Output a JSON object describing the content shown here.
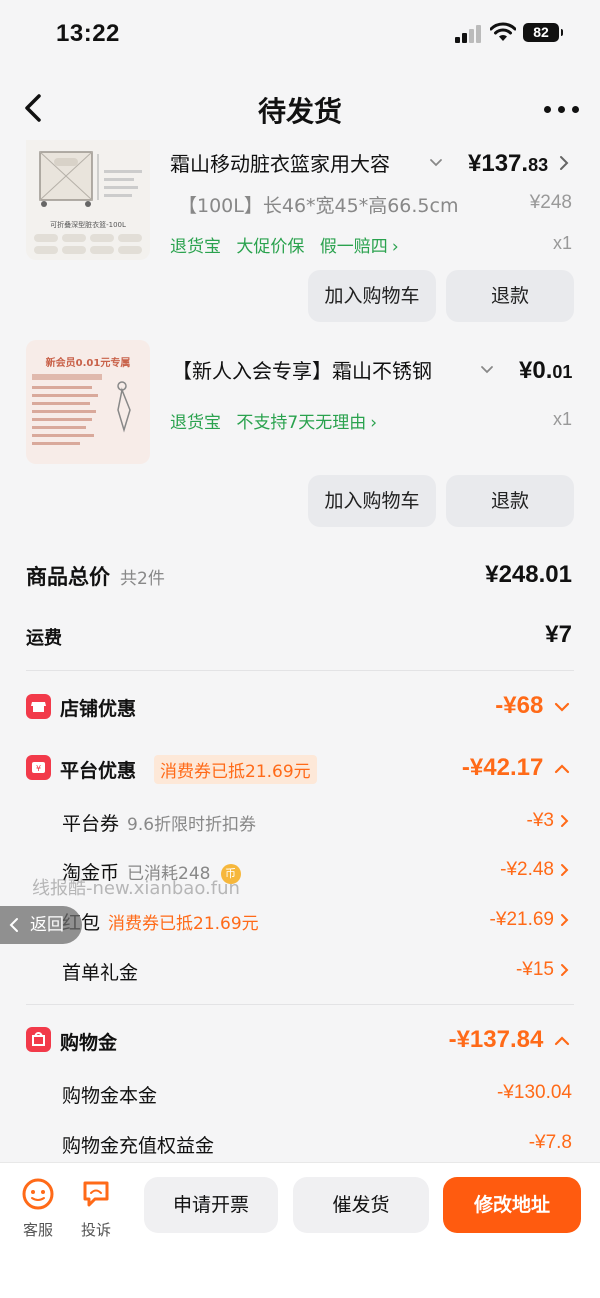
{
  "status": {
    "time": "13:22",
    "battery": "82"
  },
  "nav": {
    "title": "待发货"
  },
  "products": [
    {
      "title": "霜山移动脏衣篮家用大容",
      "price_int": "¥137.",
      "price_dec": "83",
      "spec": "【100L】长46*宽45*高66.5cm",
      "orig_price": "¥248",
      "tags": [
        "退货宝",
        "大促价保",
        "假一赔四"
      ],
      "qty": "x1",
      "thumb_caption": "可折叠深型脏衣篮-100L",
      "btn_cart": "加入购物车",
      "btn_refund": "退款"
    },
    {
      "title": "【新人入会专享】霜山不锈钢",
      "price_int": "¥0.",
      "price_dec": "01",
      "tags": [
        "退货宝",
        "不支持7天无理由"
      ],
      "qty": "x1",
      "thumb_caption": "新会员0.01元专属",
      "btn_cart": "加入购物车",
      "btn_refund": "退款"
    }
  ],
  "summary": {
    "total_label": "商品总价",
    "total_count": "共2件",
    "total_value": "¥248.01",
    "shipping_label": "运费",
    "shipping_value": "¥7"
  },
  "discounts": {
    "store": {
      "label": "店铺优惠",
      "value": "-¥68"
    },
    "platform": {
      "label": "平台优惠",
      "pill": "消费券已抵21.69元",
      "value": "-¥42.17",
      "items": [
        {
          "label": "平台券",
          "note": "9.6折限时折扣券",
          "value": "-¥3"
        },
        {
          "label": "淘金币",
          "note": "已消耗248",
          "value": "-¥2.48"
        },
        {
          "label": "红包",
          "note": "消费券已抵21.69元",
          "value": "-¥21.69"
        },
        {
          "label": "首单礼金",
          "note": "",
          "value": "-¥15"
        }
      ]
    },
    "shopping_money": {
      "label": "购物金",
      "value": "-¥137.84",
      "items": [
        {
          "label": "购物金本金",
          "value": "-¥130.04"
        },
        {
          "label": "购物金充值权益金",
          "value": "-¥7.8"
        }
      ]
    }
  },
  "overlay": {
    "watermark": "线报酷-new.xianbao.fun",
    "float_back": "返回"
  },
  "bottom": {
    "tabs": [
      {
        "label": "客服"
      },
      {
        "label": "投诉"
      }
    ],
    "buttons": [
      "申请开票",
      "催发货",
      "修改地址"
    ]
  },
  "colors": {
    "accent": "#ff5b0f",
    "green": "#2aa24e",
    "red_icon": "#f23a4a"
  }
}
